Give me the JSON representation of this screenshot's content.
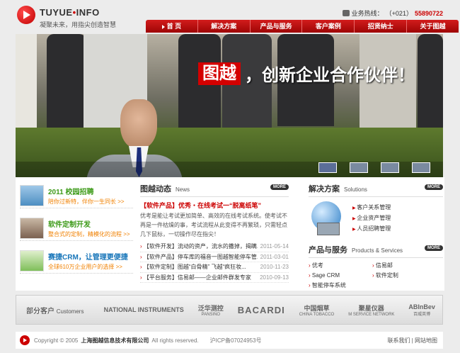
{
  "header": {
    "brand_left": "TUYUE",
    "brand_dot": "•",
    "brand_right": "INFO",
    "slogan": "凝聚未来，用指尖创造智慧",
    "hotline_label": "业务热线：",
    "hotline_area": "（+021）",
    "hotline_number": "55890722",
    "nav": [
      "首 页",
      "解决方案",
      "产品与服务",
      "客户案例",
      "招贤纳士",
      "关于图越"
    ]
  },
  "banner": {
    "brand_cn": "图越",
    "tagline": "，创新企业合作伙伴！"
  },
  "promos": [
    {
      "title": "2011 校园招聘",
      "sub": "陪你过新特，伴你一生同长 >>"
    },
    {
      "title": "软件定制开发",
      "sub": "整合式的定制，精模化的流程 >>"
    },
    {
      "title": "赛捷CRM，让管理更便捷",
      "sub": "全球610万企业用户的选择 >>"
    }
  ],
  "news": {
    "title": "图越动态",
    "en": "News",
    "more": "MORE",
    "headline": "【软件产品】优秀・在线考试一“脱离纸笔”",
    "body": "优考是能让考试更加简单、高效的在线考试系统。使考试不再是一件枯燥的事，考试流程从此变得不再繁琐，只需轻点几下鼠标，一切操作尽在指尖！",
    "items": [
      {
        "t": "【软件开发】流动的资产，流水的撒掉，揭瞒...",
        "d": "2011-05-14"
      },
      {
        "t": "【软件产品】停车库的福音一图越智能停车管...",
        "d": "2011-03-01"
      },
      {
        "t": "【软件定制】图越“白骨精” 飞越“疯狂妆...",
        "d": "2010-11-23"
      },
      {
        "t": "【平台服务】信易邮——企业邮件群发专家",
        "d": "2010-09-13"
      }
    ]
  },
  "solutions": {
    "title": "解决方案",
    "en": "Solutions",
    "more": "MORE",
    "items": [
      "客户关系管理",
      "企业资产管理",
      "人员招聘管理"
    ]
  },
  "products": {
    "title": "产品与服务",
    "en": "Products & Services",
    "more": "MORE",
    "items": [
      "优考",
      "信易邮",
      "Sage CRM",
      "软件定制",
      "智能停车系统"
    ]
  },
  "partners": {
    "label": "部分客户",
    "en": "Customers",
    "logos": [
      "NATIONAL INSTRUMENTS",
      "泛华测控",
      "BACARDI",
      "中国烟草",
      "聚星仪器",
      "ABInBev"
    ],
    "logo_subs": [
      "",
      "PANSINO",
      "",
      "CHINA TOBACCO",
      "M SERVICE NETWORK",
      "百威英博"
    ]
  },
  "footer": {
    "copyright": "Copyright © 2005",
    "company": "上海图越信息技术有限公司",
    "rights": "All rights reserved.",
    "icp": "沪ICP备07024953号",
    "links": "联系我们 | 网站地图"
  }
}
